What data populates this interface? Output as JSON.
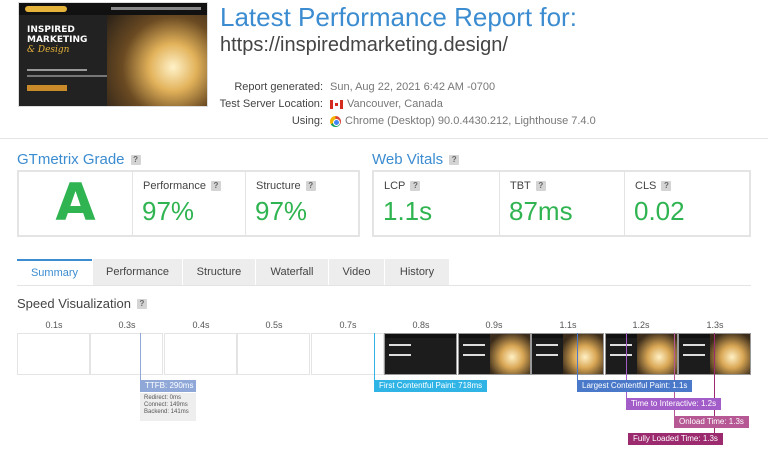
{
  "header": {
    "title": "Latest Performance Report for:",
    "url": "https://inspiredmarketing.design/",
    "thumbnail": {
      "brand_line1": "INSPIRED",
      "brand_line2": "MARKETING",
      "brand_script": "& Design"
    },
    "meta": [
      {
        "label": "Report generated:",
        "value": "Sun, Aug 22, 2021 6:42 AM -0700",
        "icon": ""
      },
      {
        "label": "Test Server Location:",
        "value": "Vancouver, Canada",
        "icon": "canada-flag-icon"
      },
      {
        "label": "Using:",
        "value": "Chrome (Desktop) 90.0.4430.212, Lighthouse 7.4.0",
        "icon": "chrome-icon"
      }
    ]
  },
  "grade": {
    "section_title": "GTmetrix Grade",
    "letter": "A",
    "performance_label": "Performance",
    "performance_value": "97%",
    "structure_label": "Structure",
    "structure_value": "97%"
  },
  "vitals": {
    "section_title": "Web Vitals",
    "lcp_label": "LCP",
    "lcp_value": "1.1s",
    "tbt_label": "TBT",
    "tbt_value": "87ms",
    "cls_label": "CLS",
    "cls_value": "0.02"
  },
  "tabs": [
    "Summary",
    "Performance",
    "Structure",
    "Waterfall",
    "Video",
    "History"
  ],
  "active_tab": "Summary",
  "speed": {
    "title": "Speed Visualization",
    "ticks": [
      "0.1s",
      "0.3s",
      "0.4s",
      "0.5s",
      "0.7s",
      "0.8s",
      "0.9s",
      "1.1s",
      "1.2s",
      "1.3s"
    ],
    "markers": {
      "ttfb": "TTFB: 290ms",
      "ttfb_redirect": "Redirect: 0ms",
      "ttfb_connect": "Connect: 149ms",
      "ttfb_backend": "Backend: 141ms",
      "fcp": "First Contentful Paint: 718ms",
      "lcp": "Largest Contentful Paint: 1.1s",
      "tti": "Time to Interactive: 1.2s",
      "onload": "Onload Time: 1.3s",
      "fully_loaded": "Fully Loaded Time: 1.3s"
    }
  },
  "colors": {
    "accent_blue": "#3b8cd0",
    "grade_green": "#2fb451",
    "ttfb": "#8fa8d8",
    "fcp": "#30b4e6",
    "lcp": "#4a79c9",
    "tti": "#a35dc9",
    "onload": "#b55893",
    "fully_loaded": "#9b2a6e"
  }
}
